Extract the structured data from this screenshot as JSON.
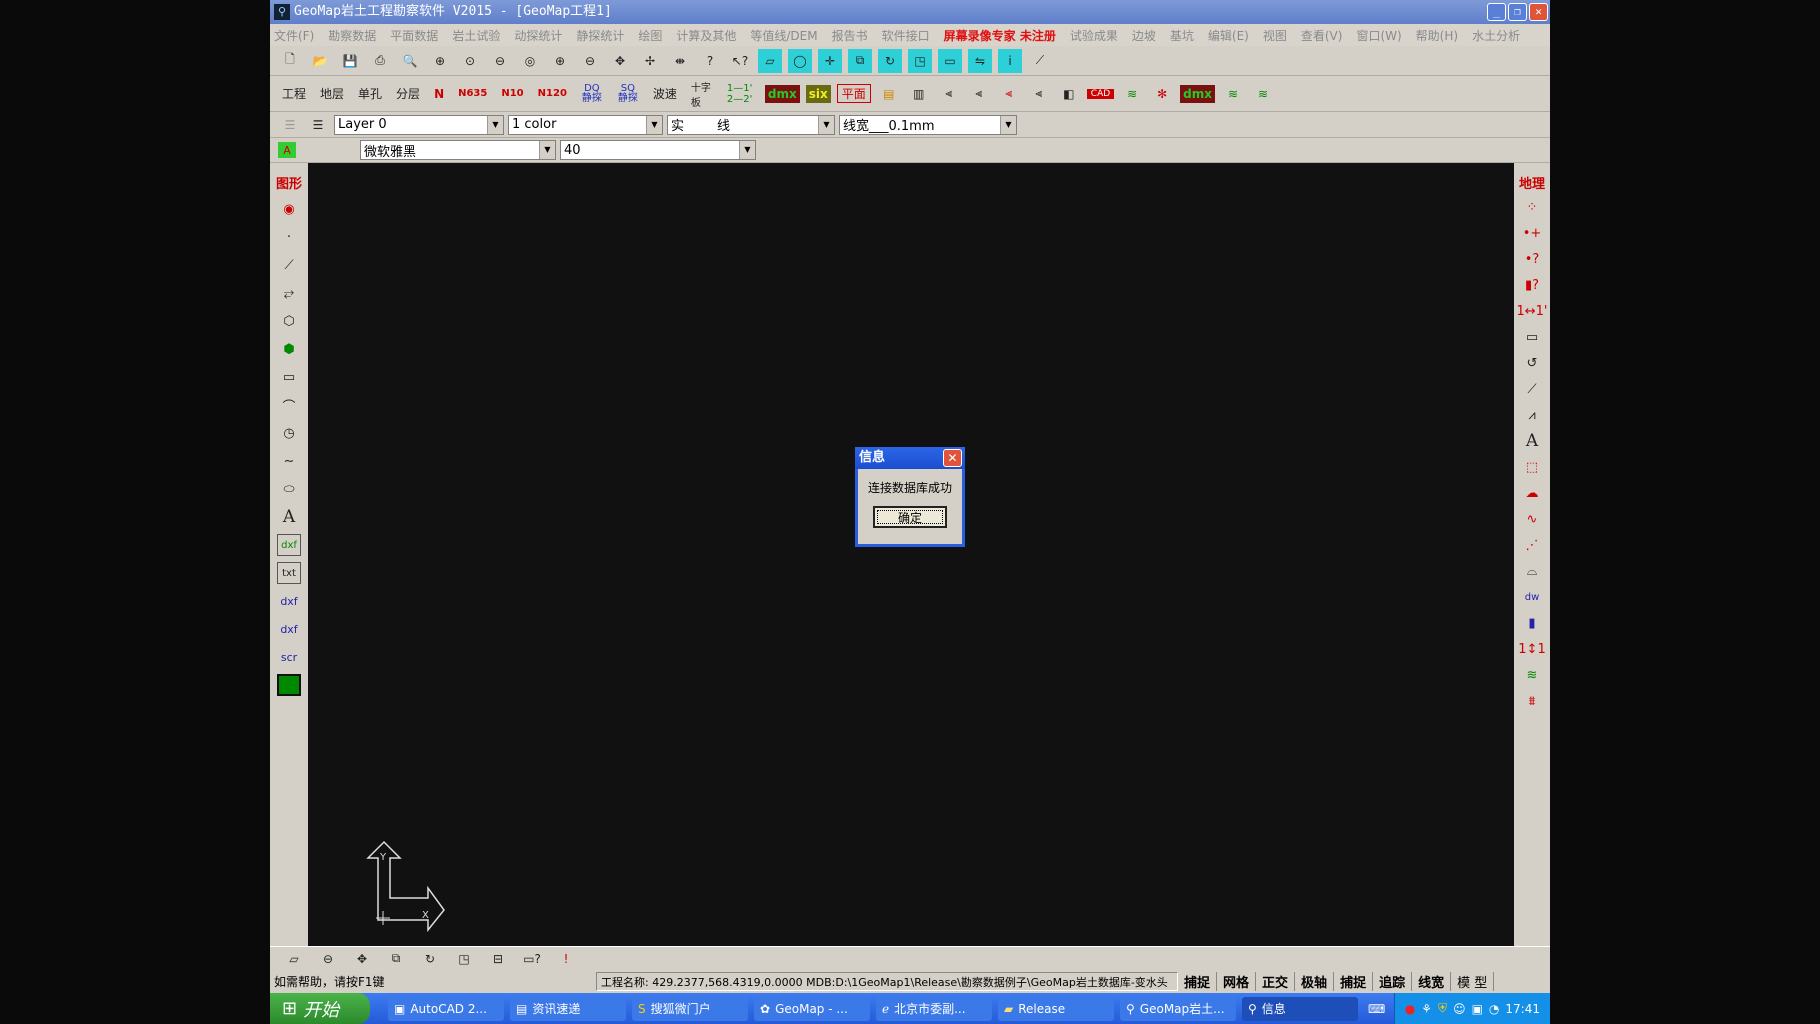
{
  "window": {
    "title": "GeoMap岩土工程勘察软件 V2015 - [GeoMap工程1]",
    "min": "_",
    "max": "❐",
    "close": "✕"
  },
  "menu": [
    "文件(F)",
    "勘察数据",
    "平面数据",
    "岩土试验",
    "动探统计",
    "静探统计",
    "绘图",
    "计算及其他",
    "等值线/DEM",
    "报告书",
    "软件接口"
  ],
  "menu_watermark": "屏幕录像专家 未注册",
  "menu2": [
    "试验成果",
    "边坡",
    "基坑",
    "编辑(E)",
    "视图",
    "查看(V)",
    "窗口(W)",
    "帮助(H)",
    "水土分析"
  ],
  "toolbar2": {
    "labels": [
      "工程",
      "地层",
      "单孔",
      "分层"
    ],
    "n": "N",
    "n635": "N635",
    "n10": "N10",
    "n120": "N120",
    "dq": "DQ静探",
    "sq": "SQ静探",
    "wave": "波速",
    "cross": "十字板",
    "section": "1—1' 2—2'",
    "dmx": "dmx",
    "six": "six",
    "plan": "平面",
    "cad": "CAD",
    "dmx2": "dmx"
  },
  "layer": {
    "layer": "Layer 0",
    "color": "1 color",
    "linetype": "实        线",
    "linewidth": "线宽___0.1mm",
    "font": "微软雅黑",
    "size": "40"
  },
  "leftbar": {
    "title": "图形",
    "text": "A",
    "dxf": "dxf",
    "txt": "txt",
    "scr": "scr"
  },
  "rightbar": {
    "title": "地理",
    "text": "A",
    "dw": "dw"
  },
  "dialog": {
    "title": "信息",
    "message": "连接数据库成功",
    "ok": "确定"
  },
  "status": {
    "help": "如需帮助，请按F1键",
    "project": "工程名称:   429.2377,568.4319,0.0000 MDB:D:\\1GeoMap1\\Release\\勘察数据例子\\GeoMap岩土数据库-变水头",
    "toggles": [
      "捕捉",
      "网格",
      "正交",
      "极轴",
      "捕捉",
      "追踪",
      "线宽",
      "模 型"
    ]
  },
  "taskbar": {
    "start": "开始",
    "tasks": [
      "AutoCAD 2...",
      "资讯速递",
      "搜狐微门户",
      "GeoMap - ...",
      "北京市委副...",
      "Release",
      "GeoMap岩土...",
      "信息"
    ],
    "clock": "17:41"
  }
}
